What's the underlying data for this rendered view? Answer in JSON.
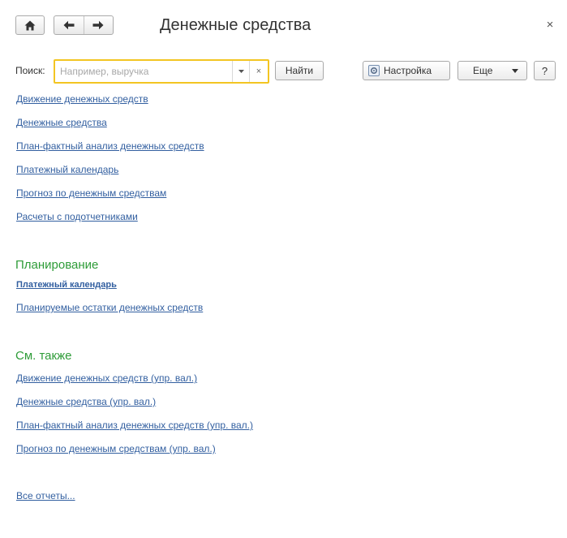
{
  "header": {
    "title": "Денежные средства",
    "close_glyph": "×",
    "icons": {
      "home": "home-icon",
      "back": "arrow-left-icon",
      "forward": "arrow-right-icon"
    }
  },
  "search": {
    "label": "Поиск:",
    "placeholder": "Например, выручка",
    "value": "",
    "clear_glyph": "×",
    "find_label": "Найти",
    "accent_color": "#f3c522"
  },
  "toolbar": {
    "settings_label": "Настройка",
    "more_label": "Еще",
    "help_label": "?"
  },
  "main_links": [
    "Движение денежных средств",
    "Денежные средства",
    "План-фактный анализ денежных средств",
    "Платежный календарь",
    "Прогноз по денежным средствам",
    "Расчеты с подотчетниками"
  ],
  "planning": {
    "title": "Планирование",
    "links": [
      "Платежный календарь",
      "Планируемые остатки денежных средств"
    ]
  },
  "see_also": {
    "title": "См. также",
    "links": [
      "Движение денежных средств (упр. вал.)",
      "Денежные средства (упр. вал.)",
      "План-фактный анализ денежных средств (упр. вал.)",
      "Прогноз по денежным средствам (упр. вал.)"
    ]
  },
  "all_reports": "Все отчеты...",
  "colors": {
    "link": "#325fa0",
    "section_title": "#2e9c38",
    "text": "#333333"
  }
}
